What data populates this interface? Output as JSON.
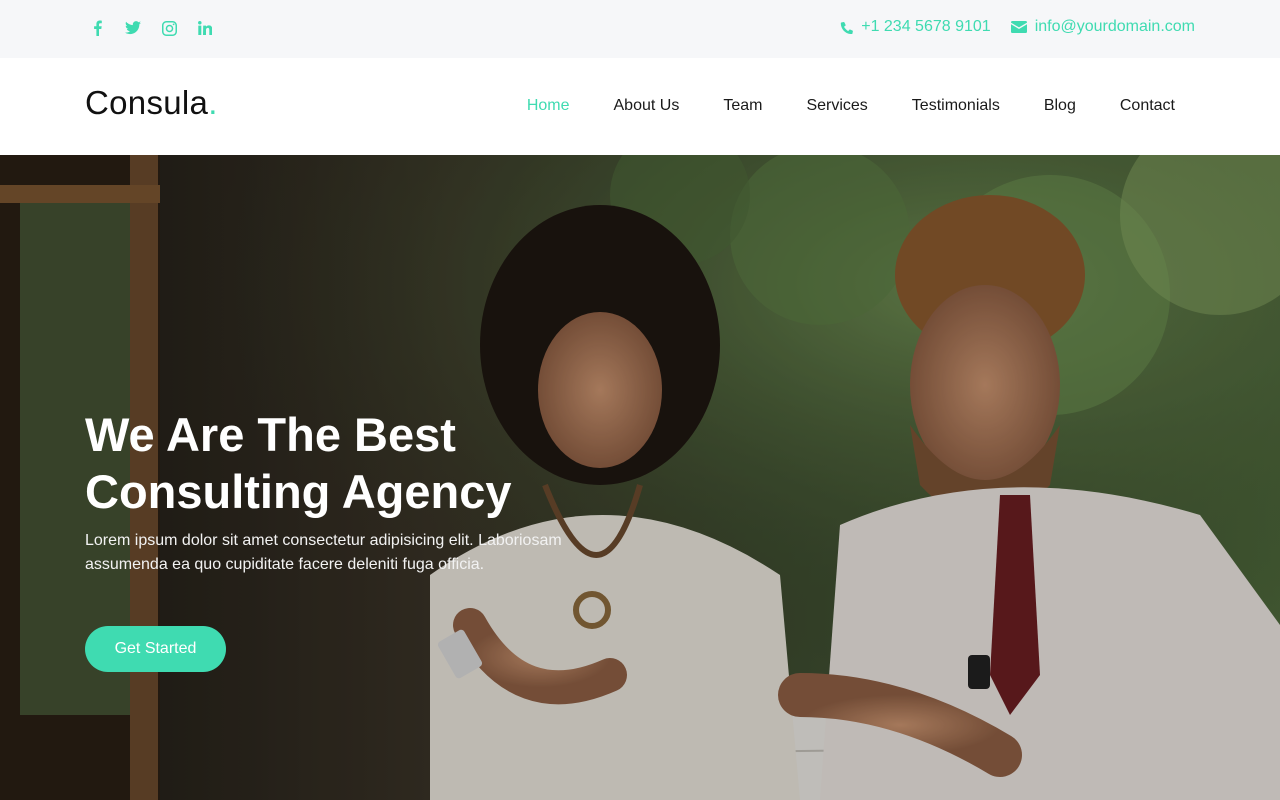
{
  "social": {
    "icons": [
      "facebook-icon",
      "twitter-icon",
      "instagram-icon",
      "linkedin-icon"
    ]
  },
  "contact": {
    "phone": "+1 234 5678 9101",
    "email": "info@yourdomain.com"
  },
  "brand": {
    "name": "Consula",
    "dot": "."
  },
  "nav": {
    "items": [
      {
        "label": "Home"
      },
      {
        "label": "About Us"
      },
      {
        "label": "Team"
      },
      {
        "label": "Services"
      },
      {
        "label": "Testimonials"
      },
      {
        "label": "Blog"
      },
      {
        "label": "Contact"
      }
    ],
    "active": "Home"
  },
  "hero": {
    "title_line1": "We Are The Best",
    "title_line2": "Consulting Agency",
    "subtitle": "Lorem ipsum dolor sit amet consectetur adipisicing elit. Laboriosam assumenda ea quo cupiditate facere deleniti fuga officia.",
    "cta_label": "Get Started"
  },
  "colors": {
    "accent": "#3fdbb1",
    "topbar_bg": "#f6f7f9",
    "text_dark": "#1a1a1a"
  }
}
